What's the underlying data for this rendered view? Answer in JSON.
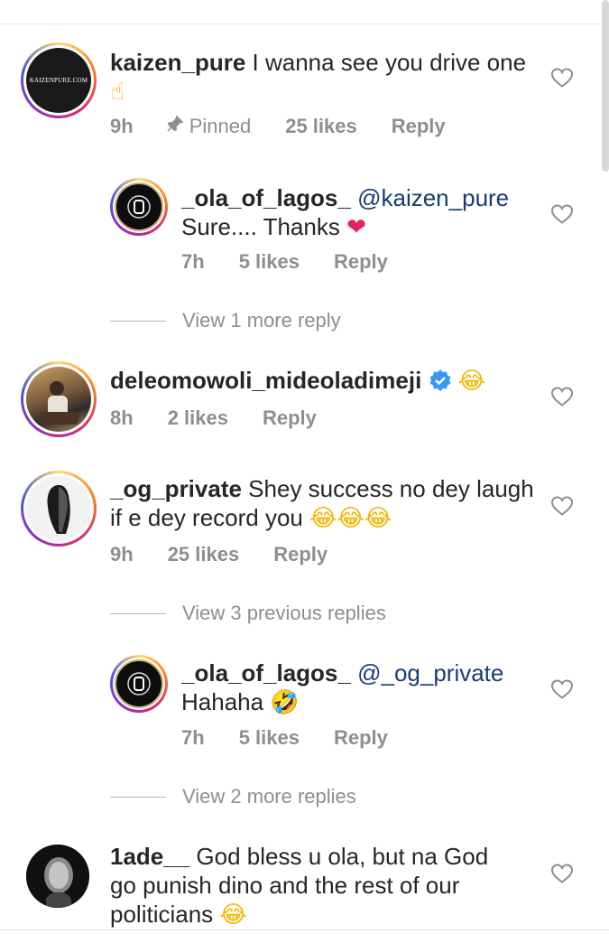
{
  "comments": [
    {
      "username": "kaizen_pure",
      "text": " I wanna see you drive one ",
      "emoji": "☝",
      "avatar_label": "KAIZENPURE.COM",
      "time": "9h",
      "pinned_label": "Pinned",
      "likes": "25 likes",
      "reply": "Reply"
    },
    {
      "username": "_ola_of_lagos_",
      "mention": "@kaizen_pure",
      "text": "Sure.... Thanks ",
      "emoji": "❤",
      "time": "7h",
      "likes": "5 likes",
      "reply": "Reply"
    },
    {
      "username": "deleomowoli_mideoladimeji",
      "emoji": "😂",
      "time": "8h",
      "likes": "2 likes",
      "reply": "Reply"
    },
    {
      "username": "_og_private",
      "text": " Shey success no dey laugh if e dey record you ",
      "emoji": "😂😂😂",
      "time": "9h",
      "likes": "25 likes",
      "reply": "Reply"
    },
    {
      "username": "_ola_of_lagos_",
      "mention": "@_og_private",
      "text": "Hahaha ",
      "emoji": "🤣",
      "time": "7h",
      "likes": "5 likes",
      "reply": "Reply"
    },
    {
      "username": "1ade__",
      "text": " God bless u ola, but na God go punish dino and the rest of our politicians ",
      "emoji": "😂"
    }
  ],
  "view_more": {
    "first": "View 1 more reply",
    "previous": "View 3 previous replies",
    "second": "View 2 more replies"
  },
  "colors": {
    "text": "#262626",
    "meta": "#8e8e8e",
    "mention": "#1a3b73",
    "verified": "#3897f0",
    "heart_red": "#e0245e"
  }
}
